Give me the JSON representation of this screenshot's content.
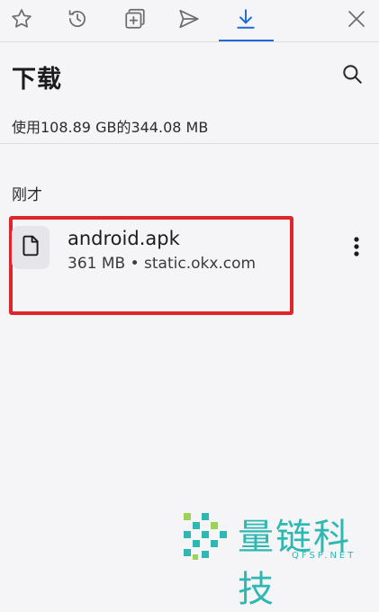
{
  "toolbar": {
    "tabs": [
      {
        "name": "star-icon"
      },
      {
        "name": "history-icon"
      },
      {
        "name": "add-tab-icon"
      },
      {
        "name": "send-icon"
      },
      {
        "name": "download-icon",
        "active": true
      },
      {
        "name": "close-icon"
      }
    ],
    "accent": "#1f6ad8"
  },
  "header": {
    "title": "下载",
    "storage": "使用108.89 GB的344.08 MB"
  },
  "sections": [
    {
      "label": "刚才",
      "items": [
        {
          "filename": "android.apk",
          "meta": "361 MB • static.okx.com",
          "highlight": "#e0252a"
        }
      ]
    }
  ],
  "watermark": {
    "text": "量链科技",
    "sub": "QFSP.NET"
  }
}
